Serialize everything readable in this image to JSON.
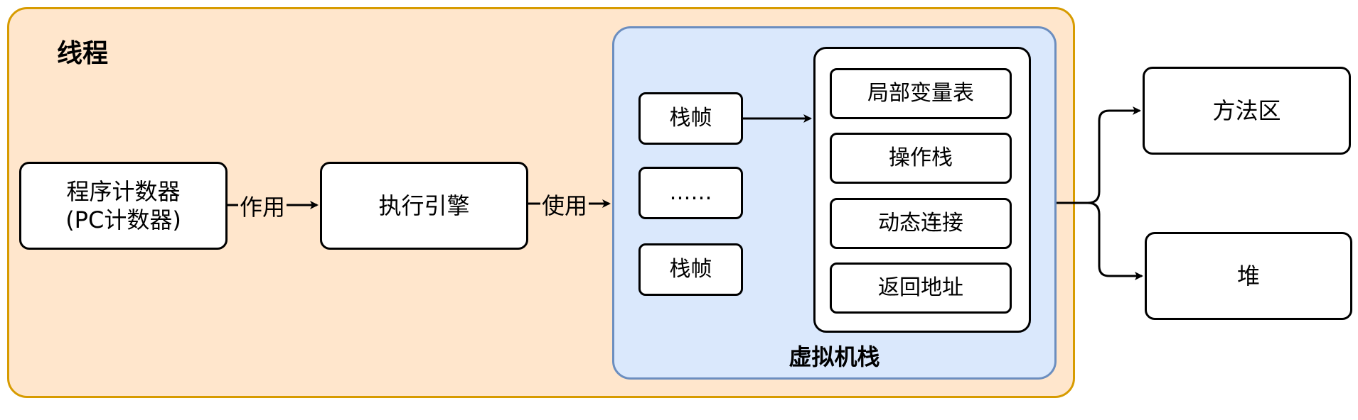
{
  "diagram": {
    "thread": {
      "label": "线程"
    },
    "pc_counter": {
      "line1": "程序计数器",
      "line2": "(PC计数器)"
    },
    "exec_engine": {
      "label": "执行引擎"
    },
    "edge_pc_to_engine": {
      "label": "作用"
    },
    "edge_engine_to_stack": {
      "label": "使用"
    },
    "vm_stack": {
      "label": "虚拟机栈",
      "frames": [
        "栈帧",
        "……",
        "栈帧"
      ],
      "frame_parts": [
        "局部变量表",
        "操作栈",
        "动态连接",
        "返回地址"
      ]
    },
    "method_area": {
      "label": "方法区"
    },
    "heap": {
      "label": "堆"
    }
  },
  "colors": {
    "thread_fill": "#ffe6cc",
    "thread_border": "#d79b00",
    "vm_fill": "#dae8fc",
    "vm_border": "#6c8ebf"
  }
}
